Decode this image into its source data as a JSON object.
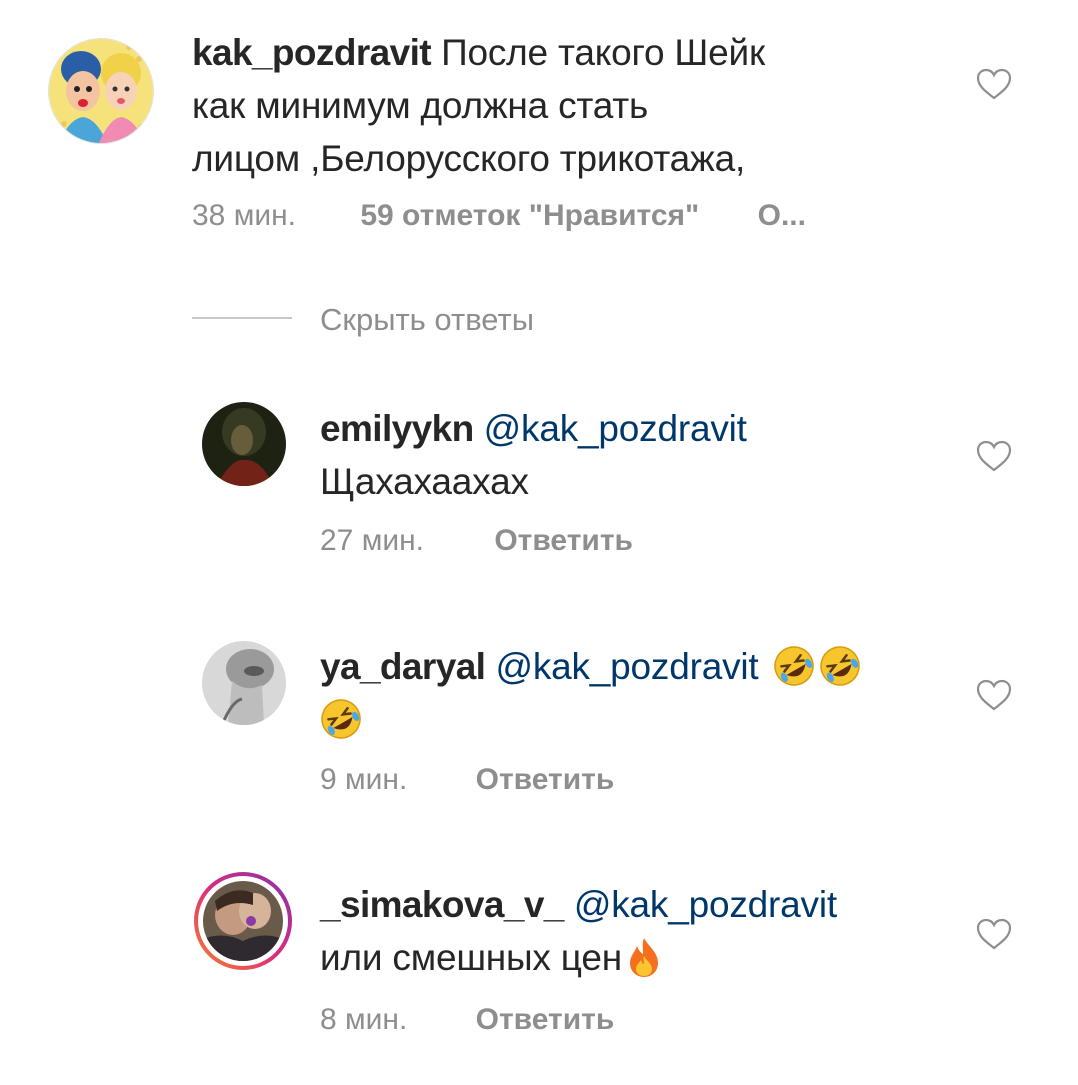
{
  "comments": [
    {
      "username": "kak_pozdravit",
      "text_lines": [
        "После такого Шейк",
        "как минимум должна стать",
        "лицом ,Белорусского трикотажа,"
      ],
      "time": "38 мин.",
      "likes": "59 отметок \"Нравится\"",
      "reply_label": "О..."
    }
  ],
  "hide_replies_label": "Скрыть ответы",
  "replies": [
    {
      "username": "emilyykn",
      "mention": "@kak_pozdravit",
      "text": "Щахахаахах",
      "time": "27 мин.",
      "reply_label": "Ответить"
    },
    {
      "username": "ya_daryal",
      "mention": "@kak_pozdravit",
      "text": "",
      "emojis": [
        "rolling-on-floor-laughing",
        "rolling-on-floor-laughing",
        "rolling-on-floor-laughing"
      ],
      "time": "9 мин.",
      "reply_label": "Ответить"
    },
    {
      "username": "_simakova_v_",
      "mention": "@kak_pozdravit",
      "text": "или смешных цен",
      "emojis": [
        "fire"
      ],
      "time": "8 мин.",
      "reply_label": "Ответить"
    }
  ],
  "colors": {
    "text": "#262626",
    "secondary": "#8e8e8e",
    "mention": "#00376b",
    "story_ring_start": "#f58529",
    "story_ring_end": "#dd2a7b"
  }
}
